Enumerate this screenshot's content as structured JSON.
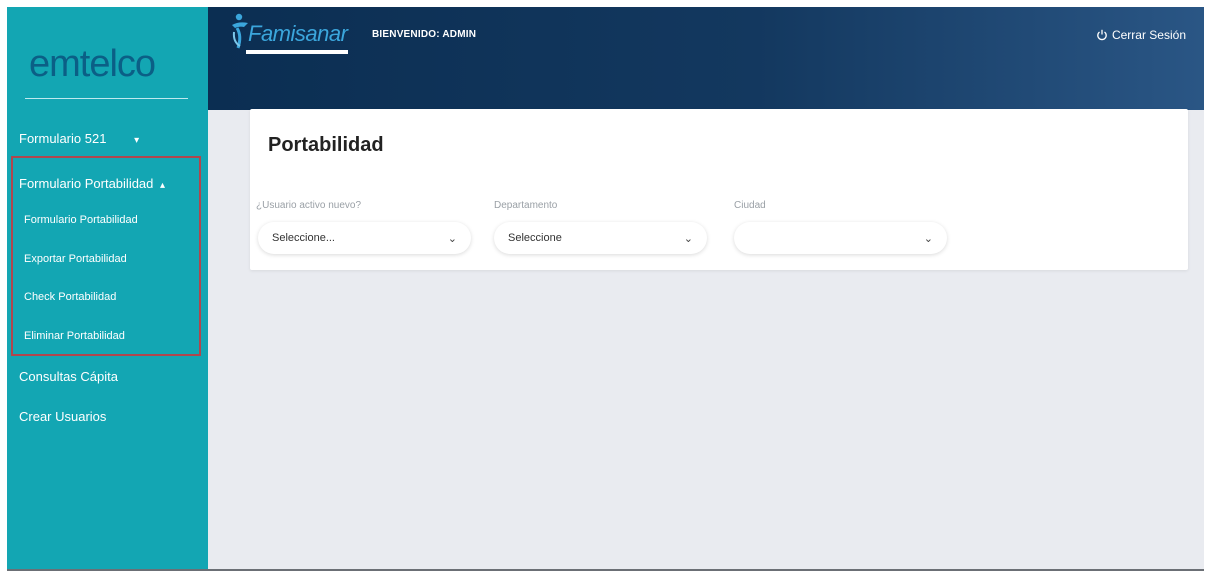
{
  "sidebar": {
    "logo": "emtelco",
    "items": [
      {
        "label": "Formulario 521",
        "caret": "▾"
      },
      {
        "label": "Formulario Portabilidad",
        "caret": "▴"
      },
      {
        "label": "Consultas Cápita"
      },
      {
        "label": "Crear Usuarios"
      }
    ],
    "submenu": [
      {
        "label": "Formulario Portabilidad"
      },
      {
        "label": "Exportar Portabilidad"
      },
      {
        "label": "Check Portabilidad"
      },
      {
        "label": "Eliminar Portabilidad"
      }
    ]
  },
  "header": {
    "brand": "Famisanar",
    "welcome": "BIENVENIDO: ADMIN",
    "logout_icon": "power-icon",
    "logout_label": "Cerrar Sesión"
  },
  "card": {
    "title": "Portabilidad",
    "fields": [
      {
        "label": "¿Usuario activo nuevo?",
        "value": "Seleccione..."
      },
      {
        "label": "Departamento",
        "value": "Seleccione"
      },
      {
        "label": "Ciudad",
        "value": ""
      }
    ]
  },
  "colors": {
    "sidebar": "#13a6b3",
    "header": "#0b2e52",
    "highlight_border": "#b0464d",
    "logo": "#0b5f86"
  }
}
